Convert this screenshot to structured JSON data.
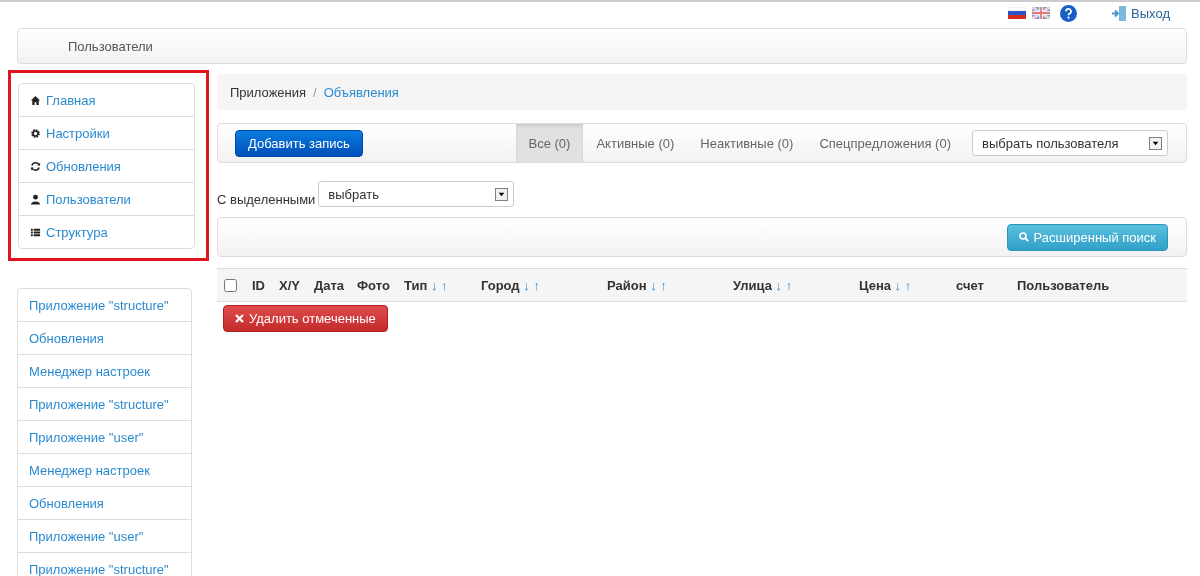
{
  "topbar": {
    "languages": [
      {
        "kind": "ru"
      },
      {
        "kind": "en"
      }
    ],
    "logout": "Выход"
  },
  "header": {
    "title": "Пользователи"
  },
  "nav": [
    {
      "label": "Главная",
      "kind": "home"
    },
    {
      "label": "Настройки",
      "kind": "settings"
    },
    {
      "label": "Обновления",
      "kind": "updates"
    },
    {
      "label": "Пользователи",
      "kind": "users"
    },
    {
      "label": "Структура",
      "kind": "structure"
    }
  ],
  "recent": [
    "Приложение \"structure\"",
    "Обновления",
    "Менеджер настроек",
    "Приложение \"structure\"",
    "Приложение \"user\"",
    "Менеджер настроек",
    "Обновления",
    "Приложение \"user\"",
    "Приложение \"structure\""
  ],
  "breadcrumb": {
    "current": "Приложения",
    "separator": "/",
    "link": "Объявления"
  },
  "toolbar": {
    "add_button": "Добавить запись",
    "filters": [
      {
        "label": "Все (0)",
        "selected": true
      },
      {
        "label": "Активные (0)",
        "selected": false
      },
      {
        "label": "Неактивные (0)",
        "selected": false
      },
      {
        "label": "Спецпредложения (0)",
        "selected": false
      }
    ],
    "user_select": "выбрать пользователя"
  },
  "bulk": {
    "label": "С выделенными",
    "select": "выбрать"
  },
  "search_button": "Расширенный поиск",
  "table": {
    "select_all_checked": false,
    "columns": [
      {
        "label": "ID"
      },
      {
        "label": "X/Y"
      },
      {
        "label": "Дата"
      },
      {
        "label": "Фото"
      },
      {
        "label": "Тип",
        "sort": [
          "↓",
          "↑"
        ]
      },
      {
        "label": "Город",
        "sort": [
          "↓",
          "↑"
        ]
      },
      {
        "label": "Район",
        "sort": [
          "↓",
          "↑"
        ]
      },
      {
        "label": "Улица",
        "sort": [
          "↓",
          "↑"
        ]
      },
      {
        "label": "Цена",
        "sort": [
          "↓",
          "↑"
        ]
      },
      {
        "label": "счет"
      },
      {
        "label": "Пользователь"
      }
    ]
  },
  "delete_button": "Удалить отмеченные"
}
